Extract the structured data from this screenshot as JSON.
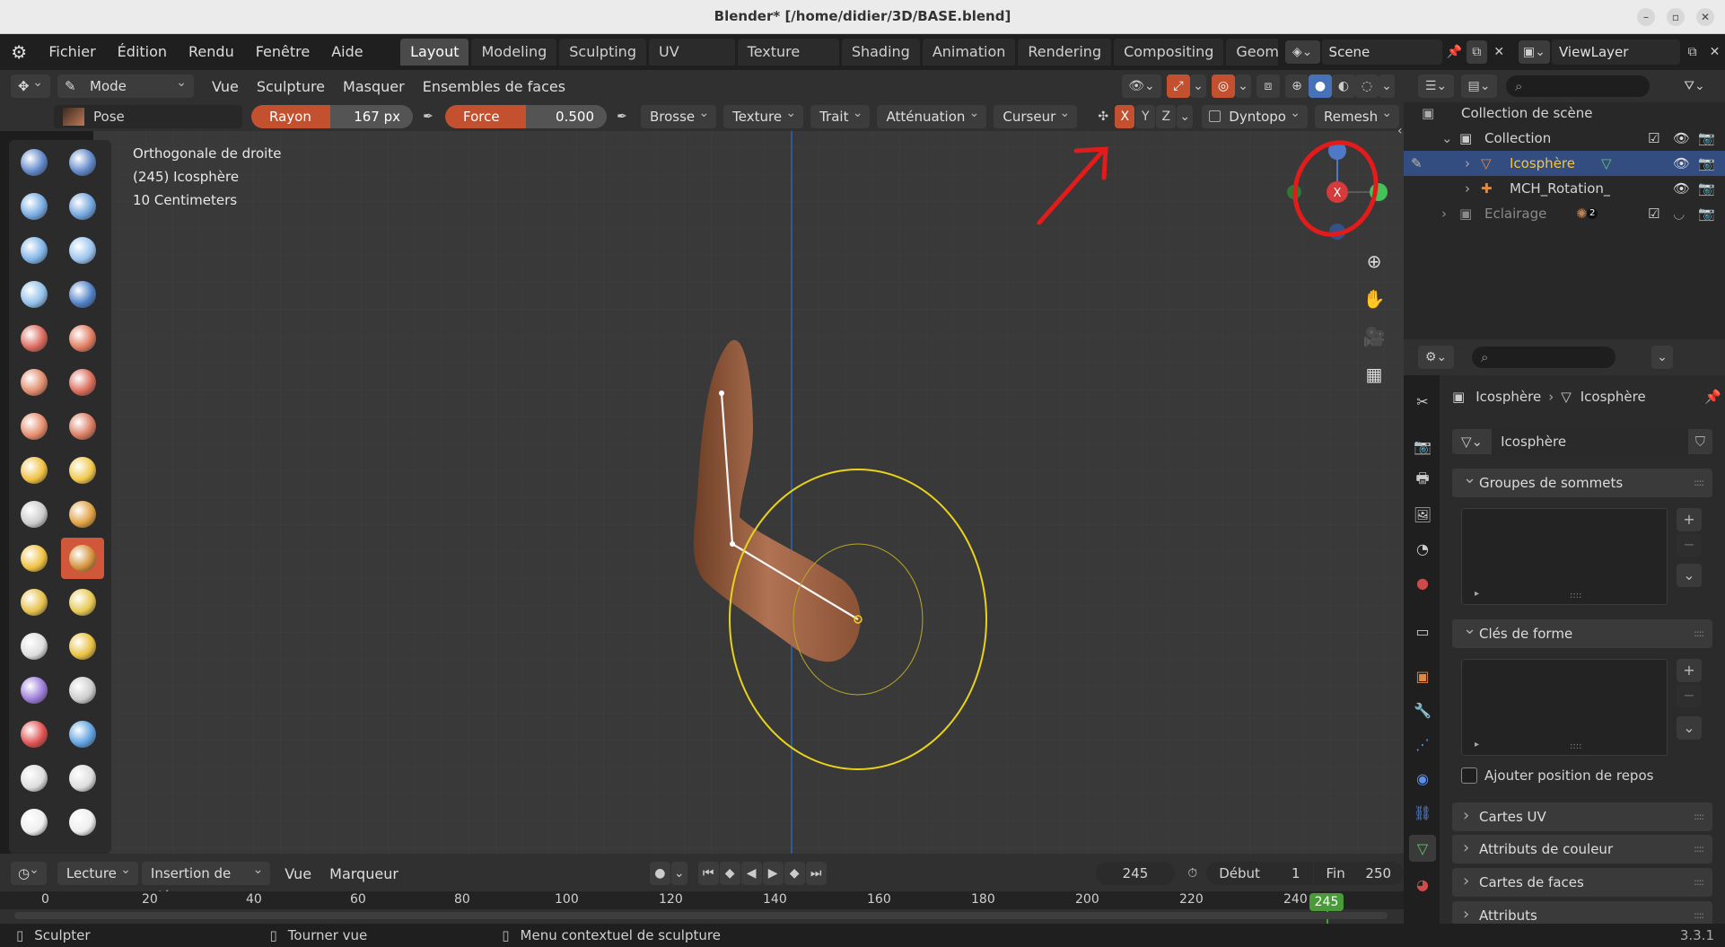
{
  "window": {
    "title": "Blender* [/home/didier/3D/BASE.blend]"
  },
  "menubar": {
    "items": [
      "Fichier",
      "Édition",
      "Rendu",
      "Fenêtre",
      "Aide"
    ],
    "workspaces": [
      "Layout",
      "Modeling",
      "Sculpting",
      "UV Editing",
      "Texture Paint",
      "Shading",
      "Animation",
      "Rendering",
      "Compositing",
      "Geome"
    ],
    "active_workspace": "Layout",
    "scene": "Scene",
    "view_layer": "ViewLayer"
  },
  "header": {
    "mode": "Mode sculpt...",
    "menus": [
      "Vue",
      "Sculpture",
      "Masquer",
      "Ensembles de faces"
    ]
  },
  "tool_settings": {
    "brush_name": "Pose",
    "radius_label": "Rayon",
    "radius_value": "167 px",
    "strength_label": "Force",
    "strength_value": "0.500",
    "strength_fraction": 0.5,
    "dropdowns": [
      "Brosse",
      "Texture",
      "Trait",
      "Atténuation",
      "Curseur"
    ],
    "axes": [
      "X",
      "Y",
      "Z"
    ],
    "dyntopo": "Dyntopo",
    "remesh": "Remesh"
  },
  "viewport": {
    "info_lines": [
      "Orthogonale de droite",
      "(245) Icosphère",
      "10 Centimeters"
    ],
    "gizmo_axis": "X",
    "accent_color": "#e8d21a"
  },
  "outliner": {
    "rows": [
      {
        "label": "Collection de scène",
        "indent": 0
      },
      {
        "label": "Collection",
        "indent": 1
      },
      {
        "label": "Icosphère",
        "indent": 2
      },
      {
        "label": "MCH_Rotation_targ",
        "indent": 2
      },
      {
        "label": "Eclairage",
        "indent": 1
      }
    ],
    "eclairage_badge": "2"
  },
  "properties": {
    "breadcrumb": [
      "Icosphère",
      "Icosphère"
    ],
    "mesh_name": "Icosphère",
    "panels": {
      "vertex_groups": "Groupes de sommets",
      "shape_keys": "Clés de forme",
      "rest_position": "Ajouter position de repos",
      "uv_maps": "Cartes UV",
      "color_attributes": "Attributs de couleur",
      "face_maps": "Cartes de faces",
      "attributes": "Attributs"
    }
  },
  "timeline": {
    "playback": "Lecture",
    "keying": "Insertion de clés",
    "view": "Vue",
    "marker": "Marqueur",
    "current_frame": "245",
    "start_label": "Début",
    "start": "1",
    "end_label": "Fin",
    "end": "250",
    "ruler": [
      "0",
      "20",
      "40",
      "60",
      "80",
      "100",
      "120",
      "140",
      "160",
      "180",
      "200",
      "220",
      "240"
    ],
    "playhead": "245"
  },
  "status": {
    "left": "Sculpter",
    "middle": "Tourner vue",
    "right": "Menu contextuel de sculpture",
    "version": "3.3.1"
  }
}
